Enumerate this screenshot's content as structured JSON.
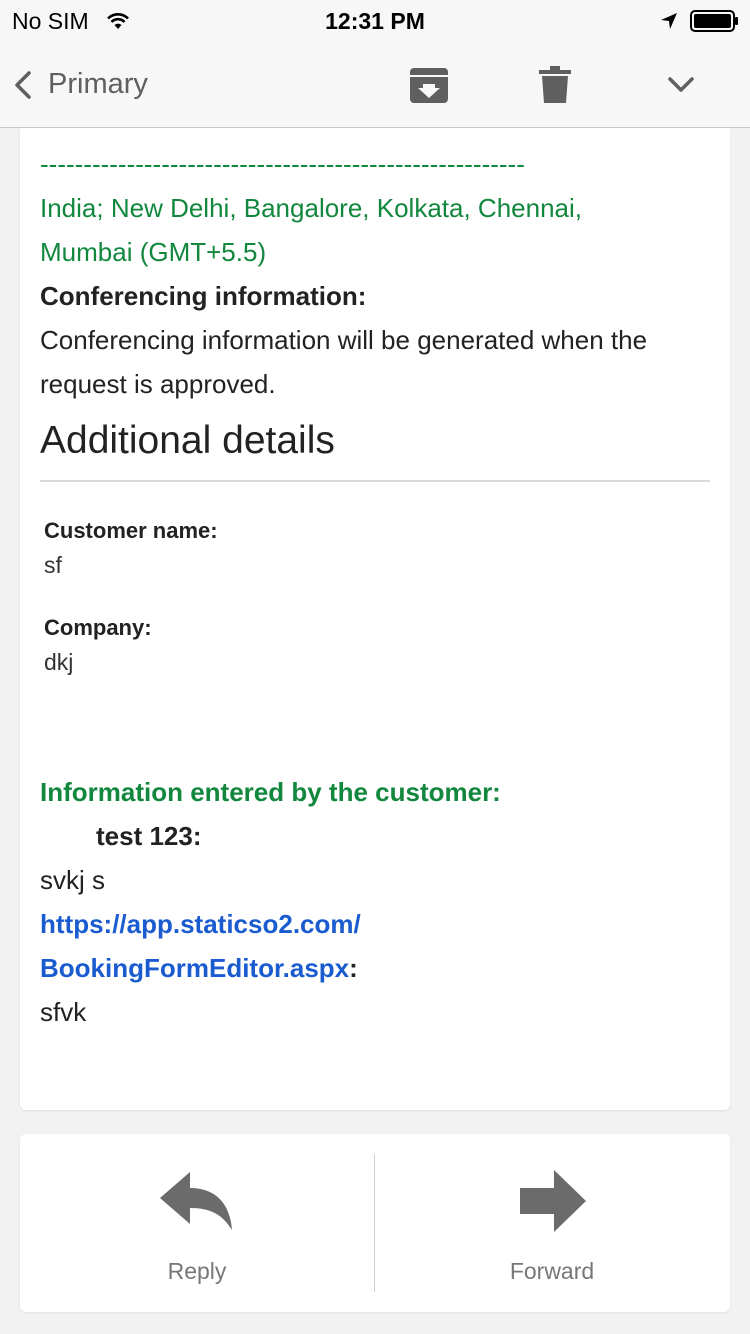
{
  "status_bar": {
    "carrier": "No SIM",
    "time": "12:31 PM"
  },
  "nav": {
    "back_label": "Primary",
    "icons": [
      "chevron-left-icon",
      "archive-icon",
      "trash-icon",
      "chevron-down-icon"
    ]
  },
  "email": {
    "dashes": "--------------------------------------------------------",
    "timezone_line1": "India; New Delhi, Bangalore, Kolkata, Chennai,",
    "timezone_line2": "Mumbai (GMT+5.5)",
    "conferencing_heading": "Conferencing information:",
    "conferencing_line1": "Conferencing information will be generated when the",
    "conferencing_line2": "request is approved.",
    "additional_details_title": "Additional details",
    "fields": [
      {
        "label": "Customer name:",
        "value": "sf"
      },
      {
        "label": "Company:",
        "value": "dkj"
      }
    ],
    "customer_info_heading": "Information entered by the customer:",
    "question1": "test 123:",
    "answer1": "svkj s",
    "link_line1": "https://app.staticso2.com/",
    "link_line2": "BookingFormEditor.aspx",
    "link_colon": ":",
    "answer2": "sfvk"
  },
  "actions": {
    "reply_label": "Reply",
    "forward_label": "Forward"
  },
  "colors": {
    "green": "#12873e",
    "link_blue": "#1a5bd0",
    "icon_gray": "#6b6b6b"
  }
}
